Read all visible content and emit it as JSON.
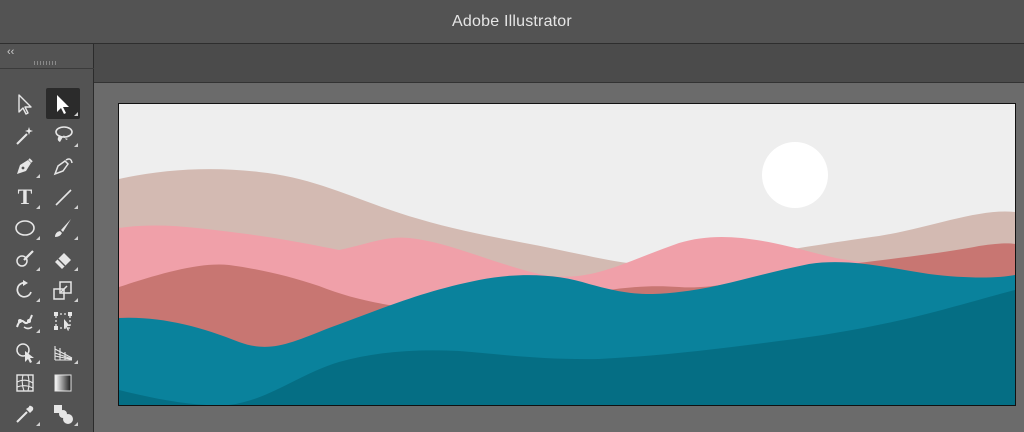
{
  "app": {
    "title": "Adobe Illustrator"
  },
  "toolbar": {
    "collapse_glyph": "‹‹",
    "tools": [
      {
        "name": "direct-selection-tool",
        "icon": "hollow-arrow-icon"
      },
      {
        "name": "selection-tool",
        "icon": "solid-arrow-icon",
        "active": true
      },
      {
        "name": "magic-wand-tool",
        "icon": "magic-wand-icon"
      },
      {
        "name": "lasso-tool",
        "icon": "lasso-icon"
      },
      {
        "name": "pen-tool",
        "icon": "pen-icon"
      },
      {
        "name": "curvature-tool",
        "icon": "curvature-pen-icon"
      },
      {
        "name": "type-tool",
        "icon": "type-icon",
        "glyph": "T"
      },
      {
        "name": "line-segment-tool",
        "icon": "line-icon"
      },
      {
        "name": "ellipse-tool",
        "icon": "ellipse-icon"
      },
      {
        "name": "paintbrush-tool",
        "icon": "paintbrush-icon"
      },
      {
        "name": "shaper-tool",
        "icon": "shaper-icon"
      },
      {
        "name": "eraser-tool",
        "icon": "eraser-icon"
      },
      {
        "name": "rotate-tool",
        "icon": "rotate-icon"
      },
      {
        "name": "scale-tool",
        "icon": "scale-icon"
      },
      {
        "name": "puppet-warp-tool",
        "icon": "puppet-warp-icon"
      },
      {
        "name": "free-transform-tool",
        "icon": "free-transform-icon"
      },
      {
        "name": "shape-builder-tool",
        "icon": "shape-builder-icon"
      },
      {
        "name": "perspective-grid-tool",
        "icon": "perspective-grid-icon"
      },
      {
        "name": "mesh-tool",
        "icon": "mesh-icon"
      },
      {
        "name": "gradient-tool",
        "icon": "gradient-icon"
      },
      {
        "name": "eyedropper-tool",
        "icon": "eyedropper-icon"
      },
      {
        "name": "blend-tool",
        "icon": "blend-icon"
      }
    ]
  },
  "artwork": {
    "colors": {
      "sky": "#eeeeee",
      "sun": "#ffffff",
      "far_hill": "#d3bab2",
      "pink_hill": "#f0a0a9",
      "rose_hill": "#c87672",
      "teal": "#0a829c",
      "deep_teal": "#056e84"
    }
  }
}
